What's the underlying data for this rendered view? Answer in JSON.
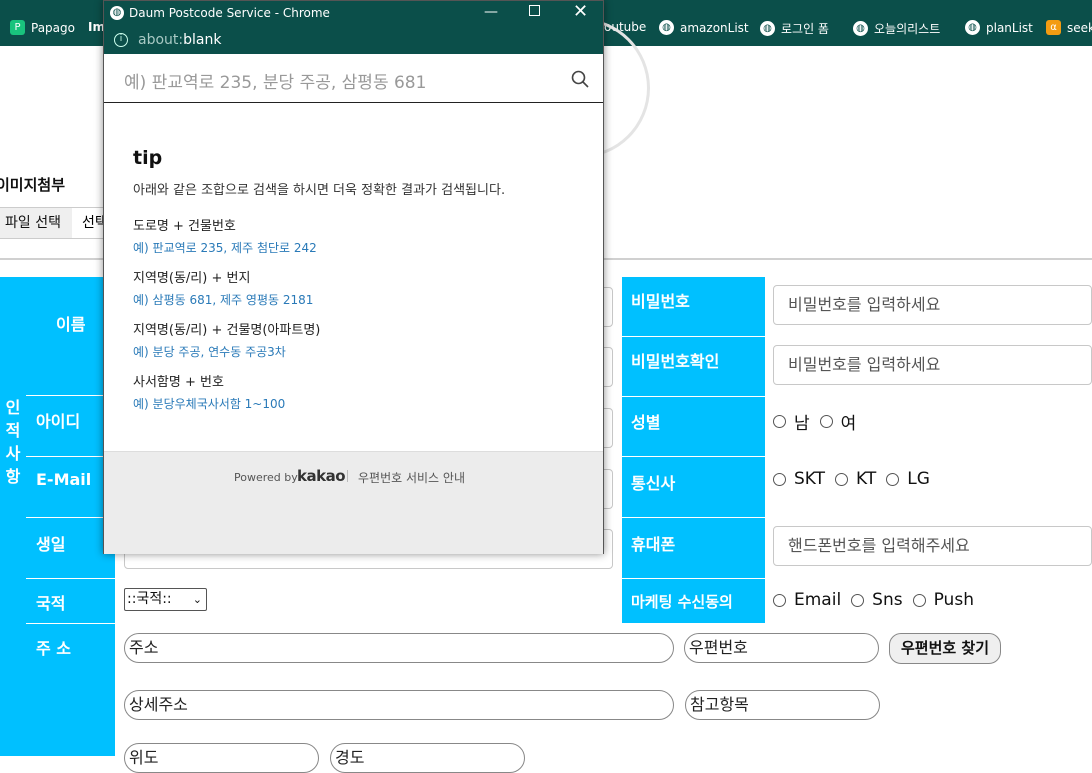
{
  "bookmarks": [
    {
      "label": "Papago",
      "icon": "papago-icon"
    },
    {
      "label": "Im",
      "icon": "bookmark-icon"
    },
    {
      "label": "outube",
      "icon": "globe-icon"
    },
    {
      "label": "amazonList",
      "icon": "globe-icon"
    },
    {
      "label": "로그인 폼",
      "icon": "globe-icon"
    },
    {
      "label": "오늘의리스트",
      "icon": "globe-icon"
    },
    {
      "label": "planList",
      "icon": "globe-icon"
    },
    {
      "label": "seek",
      "icon": "alpha-icon"
    }
  ],
  "popup": {
    "title": "Daum Postcode Service - Chrome",
    "url_prefix": "about:",
    "url_main": "blank",
    "search_placeholder": "예) 판교역로 235, 분당 주공, 삼평동 681",
    "tip_title": "tip",
    "tip_desc": "아래와 같은 조합으로 검색을 하시면 더욱 정확한 결과가 검색됩니다.",
    "tips": [
      {
        "head": "도로명 + 건물번호",
        "example": "예) 판교역로 235,  제주 첨단로 242"
      },
      {
        "head": "지역명(동/리) + 번지",
        "example": "예) 삼평동 681,  제주 영평동 2181"
      },
      {
        "head": "지역명(동/리) + 건물명(아파트명)",
        "example": "예) 분당 주공,  연수동 주공3차"
      },
      {
        "head": "사서함명 + 번호",
        "example": "예) 분당우체국사서함 1~100"
      }
    ],
    "powered_by": "Powered by",
    "brand": "kakao",
    "service_info": "우편번호 서비스 안내"
  },
  "page": {
    "image_attach_title": "이미지첨부",
    "file_button": "파일 선택",
    "file_status": "선택",
    "section_label": [
      "인",
      "적",
      "사",
      "항"
    ],
    "labels": {
      "name": "이름",
      "id": "아이디",
      "email": "E-Mail",
      "birth": "생일",
      "nationality": "국적",
      "address": "주 소",
      "password": "비밀번호",
      "password_confirm": "비밀번호확인",
      "gender": "성별",
      "carrier": "통신사",
      "phone": "휴대폰",
      "marketing": "마케팅 수신동의"
    },
    "password_placeholder": "비밀번호를 입력하세요",
    "password_confirm_placeholder": "비밀번호를 입력하세요",
    "phone_placeholder": "핸드폰번호를 입력해주세요",
    "gender_options": [
      "남",
      "여"
    ],
    "carrier_options": [
      "SKT",
      "KT",
      "LG"
    ],
    "marketing_options": [
      "Email",
      "Sns",
      "Push"
    ],
    "nationality_selected": "::국적::",
    "address_placeholder": "주소",
    "zip_placeholder": "우편번호",
    "zip_button": "우편번호 찾기",
    "detail_address_placeholder": "상세주소",
    "reference_placeholder": "참고항목",
    "extra1": "위도",
    "extra2": "경도"
  },
  "colors": {
    "accent": "#00c0ff",
    "titlebar": "#0b4f4a",
    "link": "#2a7ab8"
  }
}
